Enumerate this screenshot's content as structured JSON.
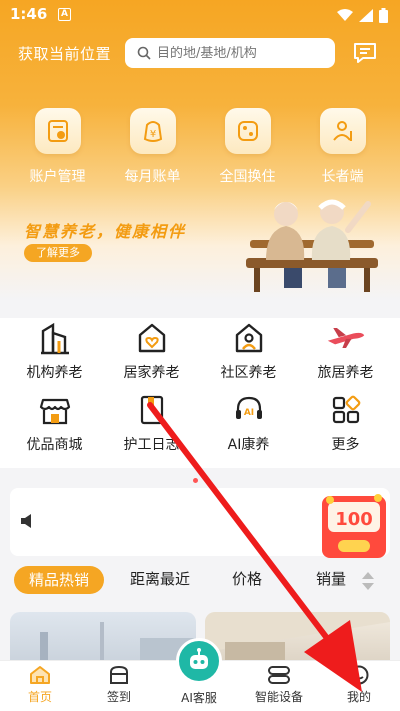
{
  "status": {
    "time": "1:46",
    "notification_letter": "A"
  },
  "header": {
    "location_label": "获取当前位置",
    "search_placeholder": "目的地/基地/机构"
  },
  "quick_actions": [
    {
      "label": "账户管理",
      "icon": "account-icon"
    },
    {
      "label": "每月账单",
      "icon": "bill-icon"
    },
    {
      "label": "全国换住",
      "icon": "swap-icon"
    },
    {
      "label": "长者端",
      "icon": "elder-icon"
    }
  ],
  "banner": {
    "slogan": "智慧养老，健康相伴",
    "button": "了解更多"
  },
  "services": {
    "row1": [
      {
        "label": "机构养老",
        "icon": "building-icon"
      },
      {
        "label": "居家养老",
        "icon": "home-heart-icon"
      },
      {
        "label": "社区养老",
        "icon": "community-icon"
      },
      {
        "label": "旅居养老",
        "icon": "airplane-icon"
      }
    ],
    "row2": [
      {
        "label": "优品商城",
        "icon": "shop-icon"
      },
      {
        "label": "护工日志",
        "icon": "diary-icon"
      },
      {
        "label": "AI康养",
        "icon": "ai-headset-icon"
      },
      {
        "label": "更多",
        "icon": "more-grid-icon"
      }
    ]
  },
  "promo": {
    "amount": "100"
  },
  "tabs": [
    "精品热销",
    "距离最近",
    "价格",
    "销量"
  ],
  "bottom_nav": [
    {
      "label": "首页",
      "icon": "home-icon"
    },
    {
      "label": "签到",
      "icon": "checkin-icon"
    },
    {
      "label": "AI客服",
      "icon": "robot-icon"
    },
    {
      "label": "智能设备",
      "icon": "device-icon"
    },
    {
      "label": "我的",
      "icon": "profile-icon"
    }
  ],
  "colors": {
    "brand": "#f5a623",
    "arrow": "#ee1c1c",
    "ai": "#1fb8a6"
  }
}
